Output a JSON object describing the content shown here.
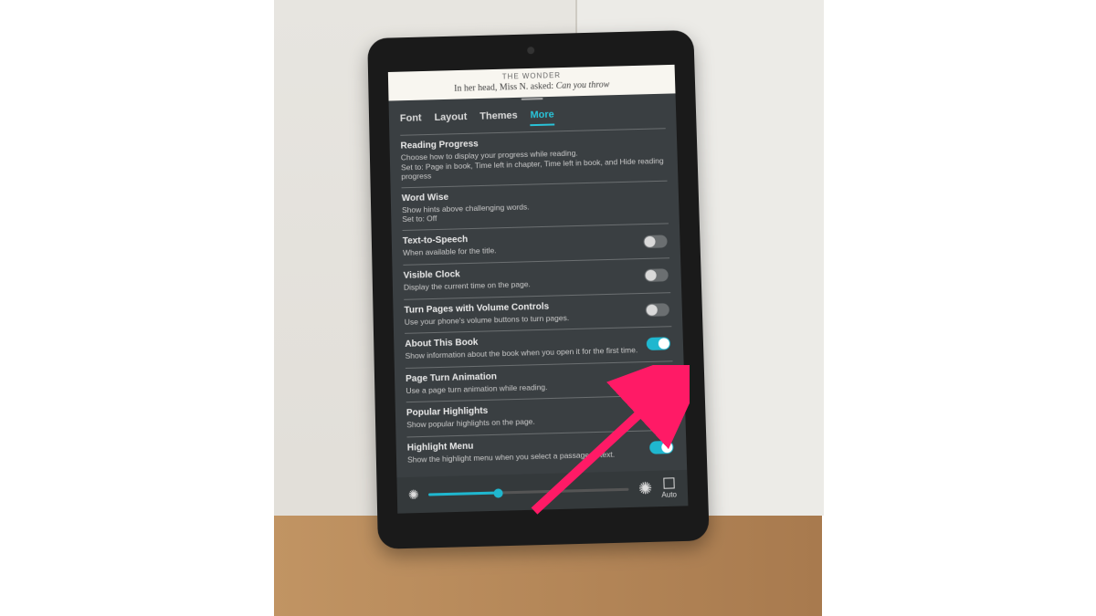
{
  "book": {
    "title_header": "THE WONDER",
    "visible_line_prefix": "In her head, Miss N. asked: ",
    "visible_line_italic": "Can you throw"
  },
  "tabs": [
    {
      "label": "Font",
      "active": false
    },
    {
      "label": "Layout",
      "active": false
    },
    {
      "label": "Themes",
      "active": false
    },
    {
      "label": "More",
      "active": true
    }
  ],
  "settings": [
    {
      "title": "Reading Progress",
      "desc": "Choose how to display your progress while reading.",
      "setto": "Set to: Page in book, Time left in chapter, Time left in book, and Hide reading progress",
      "toggle": null
    },
    {
      "title": "Word Wise",
      "desc": "Show hints above challenging words.",
      "setto": "Set to: Off",
      "toggle": null
    },
    {
      "title": "Text-to-Speech",
      "desc": "When available for the title.",
      "setto": null,
      "toggle": false
    },
    {
      "title": "Visible Clock",
      "desc": "Display the current time on the page.",
      "setto": null,
      "toggle": false
    },
    {
      "title": "Turn Pages with Volume Controls",
      "desc": "Use your phone's volume buttons to turn pages.",
      "setto": null,
      "toggle": false
    },
    {
      "title": "About This Book",
      "desc": "Show information about the book when you open it for the first time.",
      "setto": null,
      "toggle": true
    },
    {
      "title": "Page Turn Animation",
      "desc": "Use a page turn animation while reading.",
      "setto": null,
      "toggle": false
    },
    {
      "title": "Popular Highlights",
      "desc": "Show popular highlights on the page.",
      "setto": null,
      "toggle": true
    },
    {
      "title": "Highlight Menu",
      "desc": "Show the highlight menu when you select a passage of text.",
      "setto": null,
      "toggle": true
    }
  ],
  "bottom": {
    "auto_label": "Auto",
    "brightness_percent": 35
  },
  "annotation": {
    "arrow_color": "#ff1a66"
  }
}
